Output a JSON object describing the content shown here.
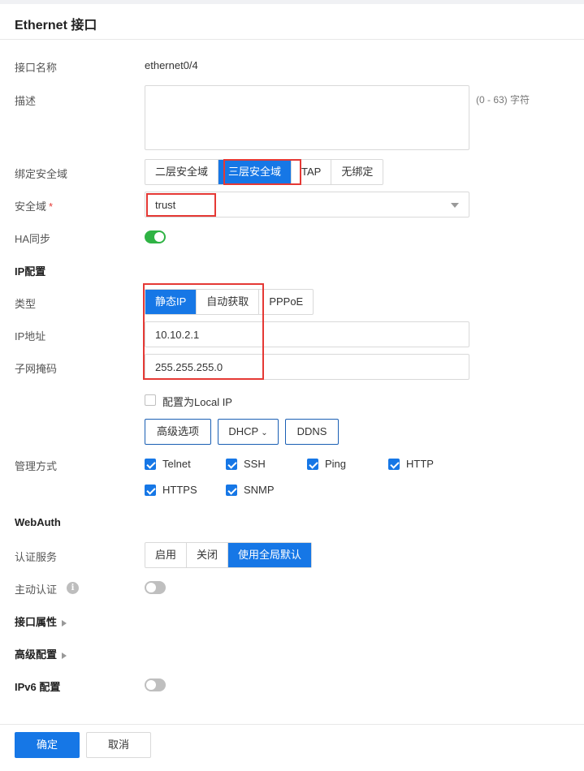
{
  "header": {
    "title": "Ethernet 接口"
  },
  "form": {
    "iface_name_label": "接口名称",
    "iface_name_value": "ethernet0/4",
    "desc_label": "描述",
    "desc_hint": "(0 - 63) 字符",
    "zone_bind_label": "绑定安全域",
    "zone_bind_options": [
      "二层安全域",
      "三层安全域",
      "TAP",
      "无绑定"
    ],
    "zone_bind_selected": "三层安全域",
    "zone_label": "安全域",
    "zone_required_mark": "*",
    "zone_value": "trust",
    "ha_label": "HA同步",
    "ha_on": true
  },
  "ip": {
    "section_title": "IP配置",
    "type_label": "类型",
    "type_options": [
      "静态IP",
      "自动获取",
      "PPPoE"
    ],
    "type_selected": "静态IP",
    "addr_label": "IP地址",
    "addr_value": "10.10.2.1",
    "mask_label": "子网掩码",
    "mask_value": "255.255.255.0",
    "local_ip_label": "配置为Local IP",
    "local_ip_checked": false,
    "adv_button": "高级选项",
    "dhcp_button": "DHCP",
    "ddns_button": "DDNS"
  },
  "mgmt": {
    "label": "管理方式",
    "items": [
      {
        "label": "Telnet",
        "checked": true
      },
      {
        "label": "SSH",
        "checked": true
      },
      {
        "label": "Ping",
        "checked": true
      },
      {
        "label": "HTTP",
        "checked": true
      },
      {
        "label": "HTTPS",
        "checked": true
      },
      {
        "label": "SNMP",
        "checked": true
      }
    ]
  },
  "webauth": {
    "section_title": "WebAuth",
    "auth_label": "认证服务",
    "auth_options": [
      "启用",
      "关闭",
      "使用全局默认"
    ],
    "auth_selected": "使用全局默认",
    "active_auth_label": "主动认证",
    "active_auth_info_icon": "i",
    "active_auth_on": false
  },
  "sections": {
    "iface_attr": "接口属性",
    "advanced": "高级配置",
    "ipv6": "IPv6 配置",
    "ipv6_on": false
  },
  "footer": {
    "ok": "确定",
    "cancel": "取消"
  },
  "colors": {
    "primary": "#1677e6",
    "highlight": "#e53935",
    "toggle_on": "#2fb344"
  }
}
